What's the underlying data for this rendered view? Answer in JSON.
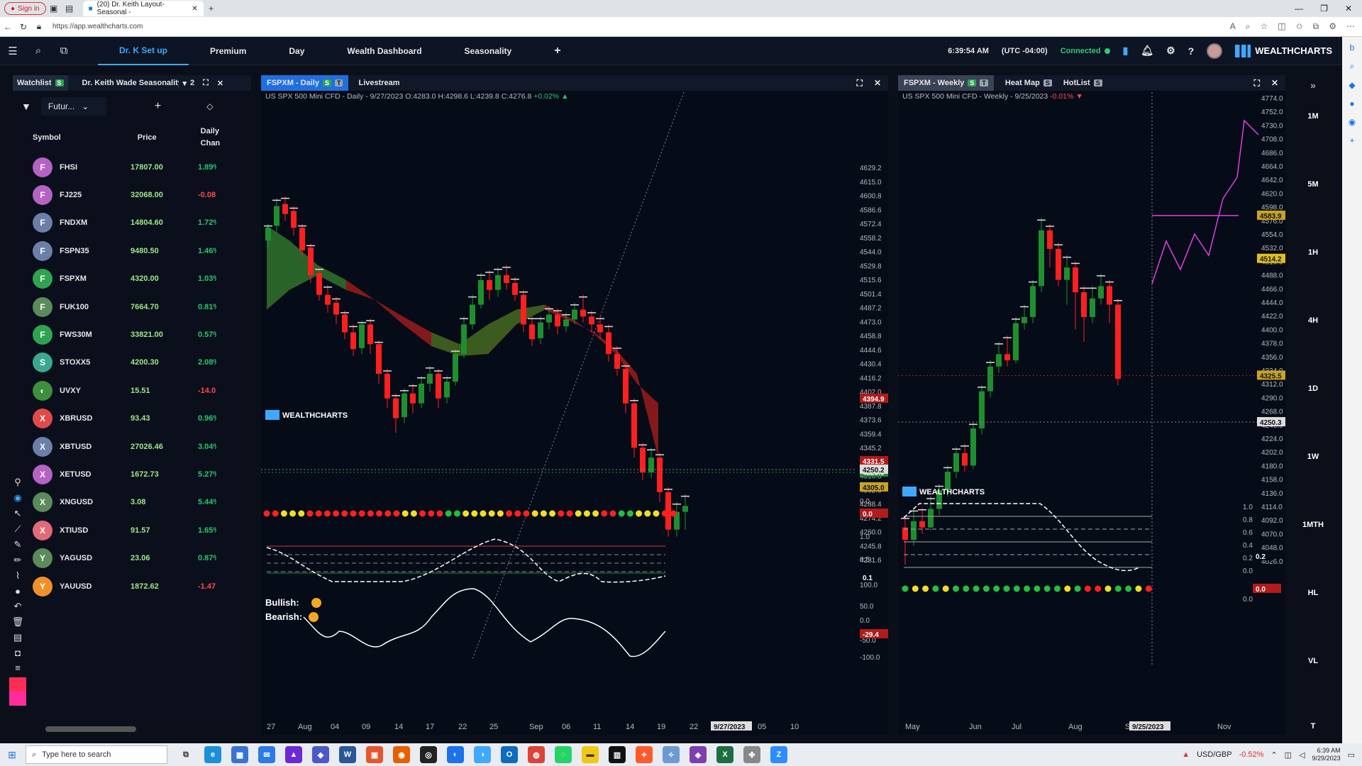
{
  "browser": {
    "signin_label": "Sign in",
    "tab_title": "(20) Dr. Keith Layout-Seasonal -",
    "url": "https://app.wealthcharts.com"
  },
  "nav": {
    "tabs": [
      {
        "label": "Dr. K Set up",
        "active": true
      },
      {
        "label": "Premium"
      },
      {
        "label": "Day"
      },
      {
        "label": "Wealth Dashboard"
      },
      {
        "label": "Seasonality"
      }
    ],
    "add_label": "+",
    "time": "6:39:54 AM",
    "timezone": "(UTC -04:00)",
    "status": "Connected",
    "brand": "WEALTHCHARTS"
  },
  "watchlist": {
    "tab1": "Watchlist",
    "tab1_badge": "S",
    "tab2": "Dr. Keith Wade Seasonality S",
    "tab_count": "2",
    "filter": "Futur...",
    "col_symbol": "Symbol",
    "col_price": "Price",
    "col_change_1": "Daily",
    "col_change_2": "Chan",
    "rows": [
      {
        "letter": "F",
        "symbol": "FHSI",
        "price": "17807.00",
        "change": "1.89%",
        "dir": "up",
        "color": "#b462c4"
      },
      {
        "letter": "F",
        "symbol": "FJ225",
        "price": "32068.00",
        "change": "-0.08",
        "dir": "down",
        "color": "#b462c4"
      },
      {
        "letter": "F",
        "symbol": "FNDXM",
        "price": "14804.60",
        "change": "1.72%",
        "dir": "up",
        "color": "#6b7fa8"
      },
      {
        "letter": "F",
        "symbol": "FSPN35",
        "price": "9480.50",
        "change": "1.46%",
        "dir": "up",
        "color": "#6b7fa8"
      },
      {
        "letter": "F",
        "symbol": "FSPXM",
        "price": "4320.00",
        "change": "1.03%",
        "dir": "up",
        "color": "#2ea44f"
      },
      {
        "letter": "F",
        "symbol": "FUK100",
        "price": "7664.70",
        "change": "0.81%",
        "dir": "up",
        "color": "#5b8a5b"
      },
      {
        "letter": "F",
        "symbol": "FWS30M",
        "price": "33821.00",
        "change": "0.57%",
        "dir": "up",
        "color": "#2ea44f"
      },
      {
        "letter": "S",
        "symbol": "STOXX5",
        "price": "4200.30",
        "change": "2.08%",
        "dir": "up",
        "color": "#3aa88e"
      },
      {
        "letter": "",
        "symbol": "UVXY",
        "price": "15.51",
        "change": "-14.0",
        "dir": "down",
        "color": "#3d8f3d"
      },
      {
        "letter": "X",
        "symbol": "XBRUSD",
        "price": "93.43",
        "change": "0.96%",
        "dir": "up",
        "color": "#e04a4a"
      },
      {
        "letter": "X",
        "symbol": "XBTUSD",
        "price": "27026.46",
        "change": "3.04%",
        "dir": "up",
        "color": "#6b7fa8"
      },
      {
        "letter": "X",
        "symbol": "XETUSD",
        "price": "1672.73",
        "change": "5.27%",
        "dir": "up",
        "color": "#b462c4"
      },
      {
        "letter": "X",
        "symbol": "XNGUSD",
        "price": "3.08",
        "change": "5.44%",
        "dir": "up",
        "color": "#5b8a5b"
      },
      {
        "letter": "X",
        "symbol": "XTIUSD",
        "price": "91.57",
        "change": "1.65%",
        "dir": "up",
        "color": "#e06a7a"
      },
      {
        "letter": "Y",
        "symbol": "YAGUSD",
        "price": "23.06",
        "change": "0.87%",
        "dir": "up",
        "color": "#5b8a5b"
      },
      {
        "letter": "Y",
        "symbol": "YAUUSD",
        "price": "1872.62",
        "change": "-1.47",
        "dir": "down",
        "color": "#f0902a"
      }
    ]
  },
  "daily_panel": {
    "tab": "FSPXM - Daily",
    "tab2": "Livestream",
    "info_name": "US SPX 500 Mini CFD",
    "info_rest": " - Daily - 9/27/2023 O:4283.0 H:4298.6 L:4239.8 C:4276.8 ",
    "info_change": "+0.02%",
    "brand": "WEALTHCHARTS",
    "bullish": "Bullish:",
    "bearish": "Bearish:",
    "price_ticks": [
      "4629.2",
      "4615.0",
      "4600.8",
      "4586.6",
      "4572.4",
      "4558.2",
      "4544.0",
      "4529.8",
      "4515.6",
      "4501.4",
      "4487.2",
      "4473.0",
      "4458.8",
      "4444.6",
      "4430.4",
      "4416.2",
      "4402.0",
      "4387.8",
      "4373.6",
      "4359.4",
      "4345.2",
      "4331.0",
      "4316.8",
      "4302.6",
      "4288.4",
      "4274.2",
      "4260.0",
      "4245.8",
      "4231.6"
    ],
    "tag_red": "4394.9",
    "tag_red2": "4331.5",
    "tag_green": "4320.0",
    "tag_gold": "4305.0",
    "tag_cross": "4250.2",
    "ind1_ticks": [
      "0.0"
    ],
    "ind1_tag": "0.0",
    "ind2_ticks": [
      "1.0",
      "0.5"
    ],
    "ind2_tag": "0.1",
    "ind3_ticks": [
      "100.0",
      "50.0",
      "0.0",
      "-50.0",
      "-100.0"
    ],
    "ind3_tag": "-29.4",
    "x_labels": [
      "27",
      "Aug",
      "04",
      "09",
      "14",
      "17",
      "22",
      "25",
      "Sep",
      "06",
      "11",
      "14",
      "19",
      "22",
      "Oct",
      "05",
      "10"
    ],
    "x_cursor": "9/27/2023"
  },
  "weekly_panel": {
    "tab": "FSPXM - Weekly",
    "tab2": "Heat Map",
    "tab3": "HotList",
    "info_name": "US SPX 500 Mini CFD",
    "info_rest": " - Weekly - 9/25/2023 ",
    "info_change": "-0.01%",
    "brand": "WEALTHCHARTS",
    "price_ticks": [
      "4774.0",
      "4752.0",
      "4730.0",
      "4708.0",
      "4686.0",
      "4664.0",
      "4642.0",
      "4620.0",
      "4598.0",
      "4576.0",
      "4554.0",
      "4532.0",
      "4510.0",
      "4488.0",
      "4466.0",
      "4444.0",
      "4422.0",
      "4400.0",
      "4378.0",
      "4356.0",
      "4334.0",
      "4312.0",
      "4290.0",
      "4268.0",
      "4246.0",
      "4224.0",
      "4202.0",
      "4180.0",
      "4158.0",
      "4136.0",
      "4114.0",
      "4092.0",
      "4070.0",
      "4048.0",
      "4026.0"
    ],
    "tag_gold1": "4583.9",
    "tag_gold2": "4514.2",
    "tag_gold3": "4325.5",
    "tag_cross": "4250.3",
    "ind1_ticks": [
      "1.0",
      "0.8",
      "0.6",
      "0.4",
      "0.2",
      "0.0"
    ],
    "ind1_tag": "0.2",
    "ind2_tag": "0.0",
    "ind2_ticks": [
      "0.0"
    ],
    "x_labels": [
      "May",
      "Jun",
      "Jul",
      "Aug",
      "Sep",
      "Nov"
    ],
    "x_cursor": "9/25/2023"
  },
  "timeframes": [
    "1M",
    "5M",
    "1H",
    "4H",
    "1D",
    "1W",
    "1MTH",
    "HL",
    "VL",
    "T"
  ],
  "taskbar": {
    "search_placeholder": "Type here to search",
    "ticker": "USD/GBP",
    "ticker_change": "-0.52%",
    "time": "6:39 AM",
    "date": "9/29/2023"
  }
}
